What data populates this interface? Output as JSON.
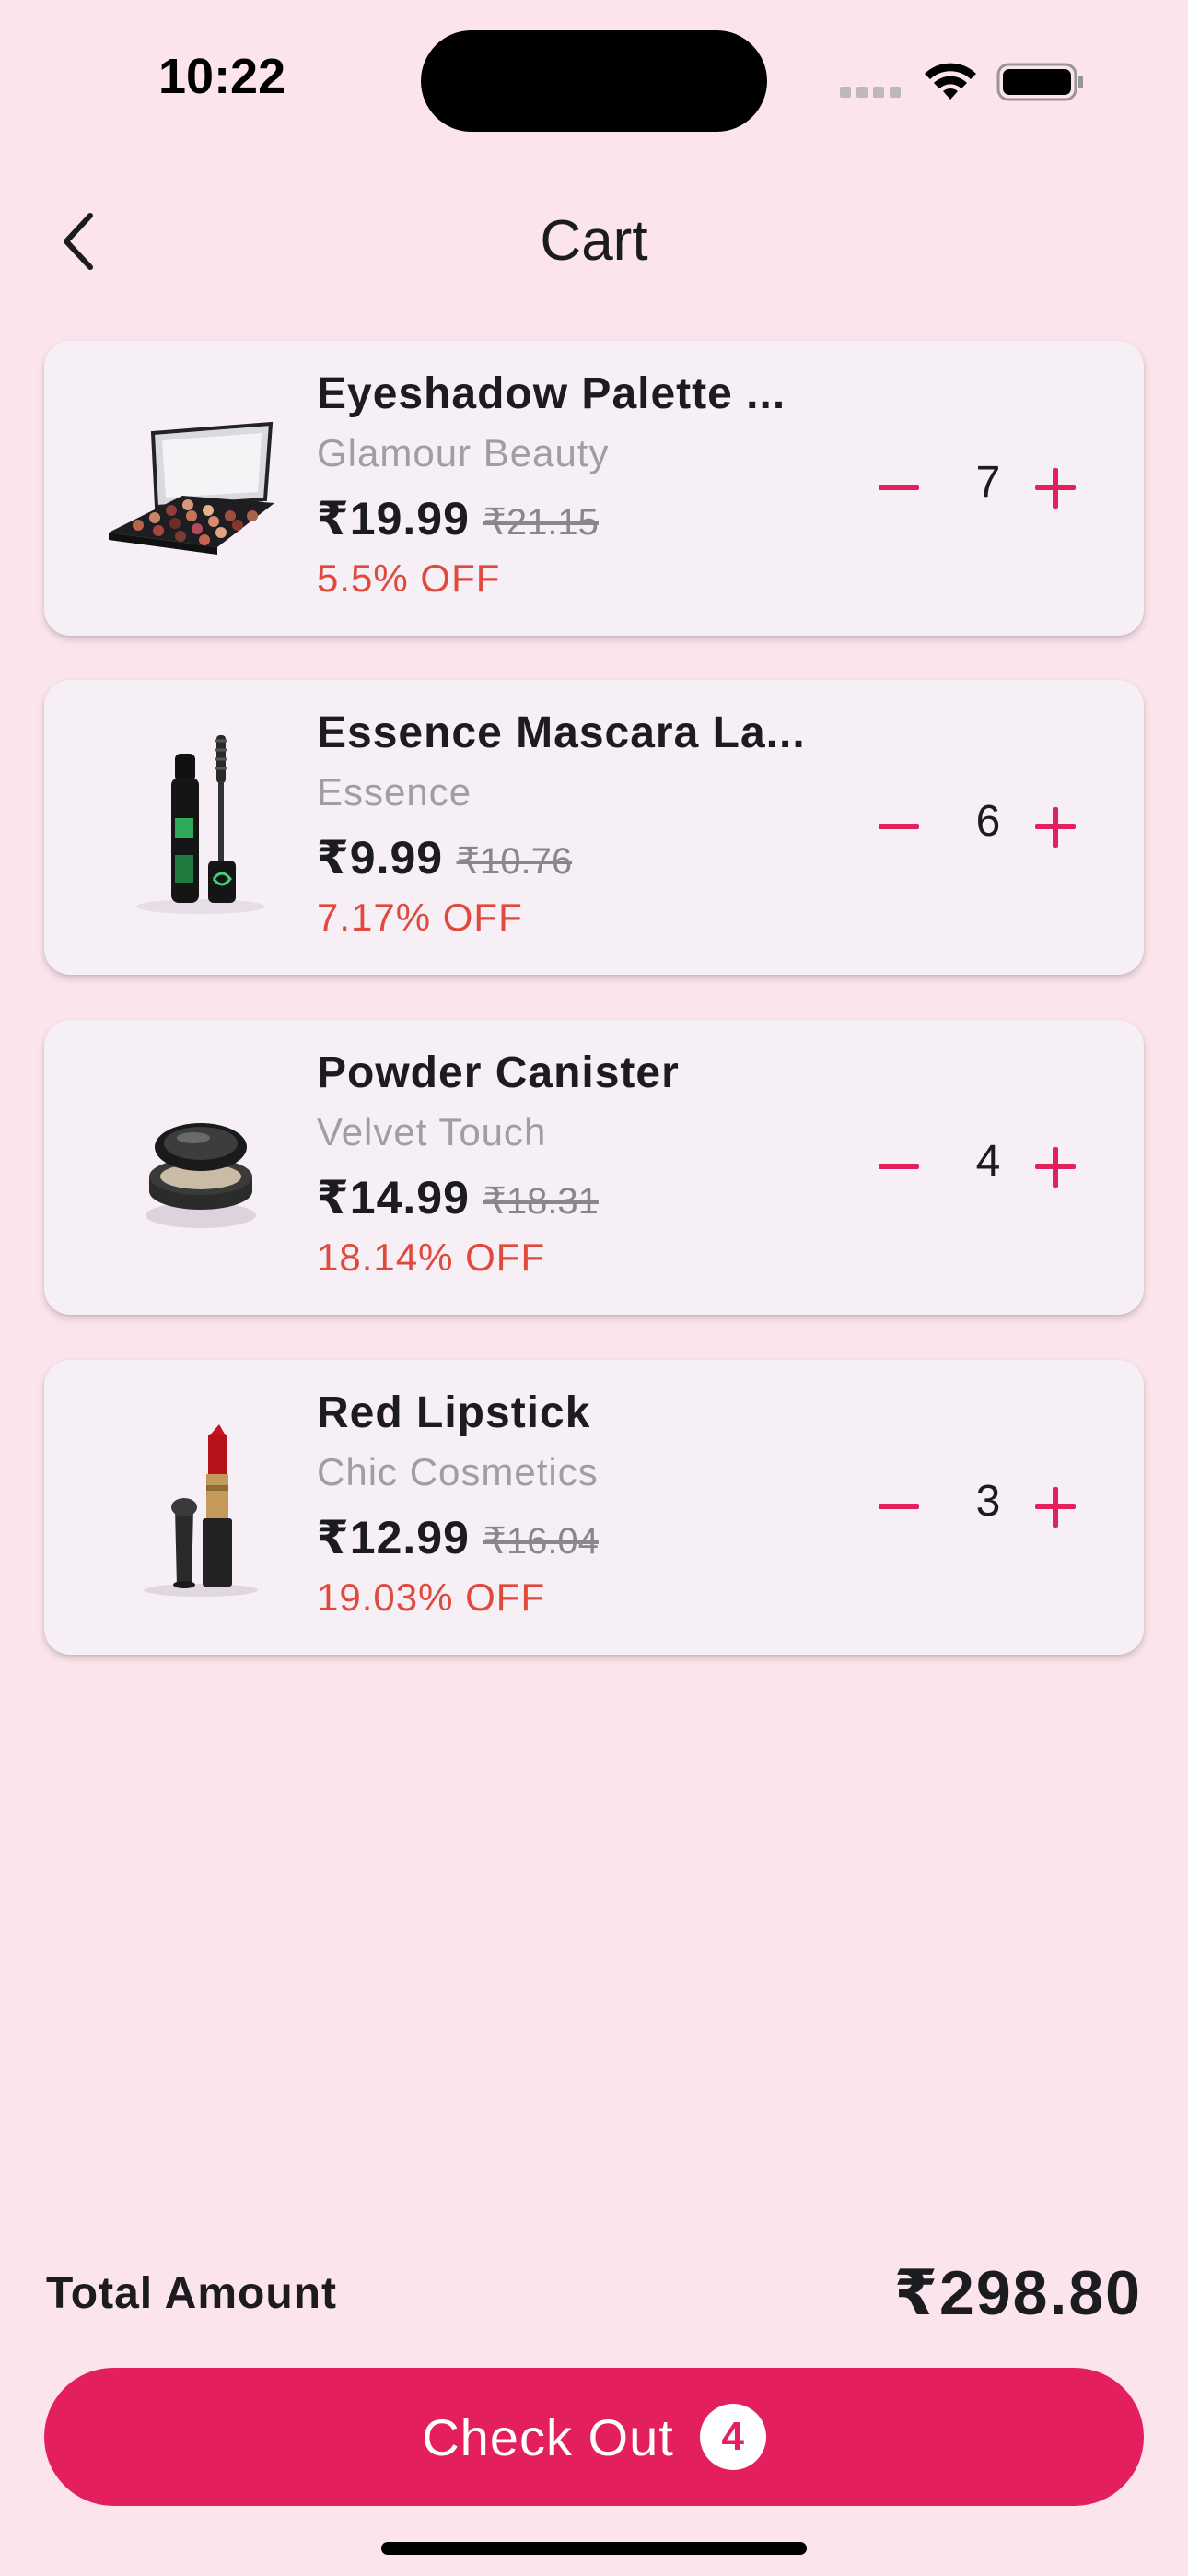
{
  "status_bar": {
    "time": "10:22"
  },
  "header": {
    "title": "Cart"
  },
  "cart": {
    "items": [
      {
        "name": "Eyeshadow Palette ...",
        "brand": "Glamour Beauty",
        "price": "₹19.99",
        "old_price": "₹21.15",
        "discount": "5.5% OFF",
        "quantity": "7",
        "icon": "eyeshadow-palette"
      },
      {
        "name": "Essence Mascara La...",
        "brand": "Essence",
        "price": "₹9.99",
        "old_price": "₹10.76",
        "discount": "7.17% OFF",
        "quantity": "6",
        "icon": "mascara"
      },
      {
        "name": "Powder Canister",
        "brand": "Velvet Touch",
        "price": "₹14.99",
        "old_price": "₹18.31",
        "discount": "18.14% OFF",
        "quantity": "4",
        "icon": "powder-compact"
      },
      {
        "name": "Red Lipstick",
        "brand": "Chic Cosmetics",
        "price": "₹12.99",
        "old_price": "₹16.04",
        "discount": "19.03% OFF",
        "quantity": "3",
        "icon": "lipstick"
      }
    ]
  },
  "footer": {
    "total_label": "Total Amount",
    "total_value": "₹298.80",
    "checkout_label": "Check Out",
    "checkout_count": "4"
  },
  "colors": {
    "background": "#FBE4EB",
    "card": "#F6EFF6",
    "accent": "#E31F5E",
    "discount": "#E04A3D",
    "muted": "#A29CA3"
  }
}
